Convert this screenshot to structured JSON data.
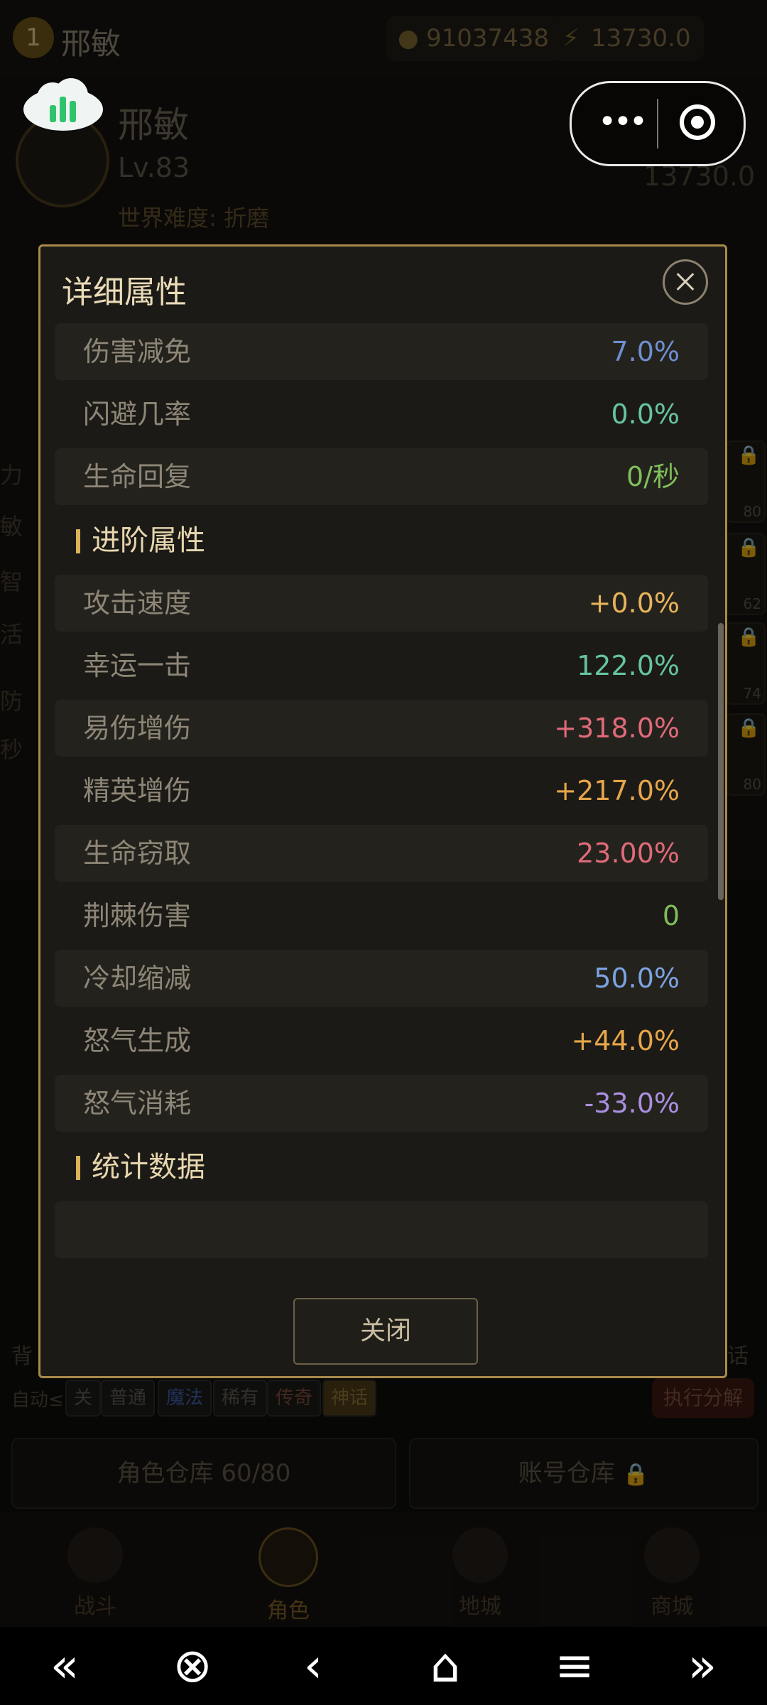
{
  "topbar": {
    "level": "1",
    "name": "邢敏",
    "gold": "91037438",
    "energy": "13730.0"
  },
  "hero": {
    "name": "邢敏",
    "level": "Lv.83",
    "difficulty": "世界难度: 折磨",
    "power": "13730.0"
  },
  "background": {
    "left_stubs": [
      "力",
      "敏",
      "智",
      "活",
      "防",
      "秒"
    ],
    "slot_numbers": [
      "80",
      "62",
      "74",
      "80"
    ],
    "bag_label": "背",
    "myth_stub": "话",
    "auto_label": "自动≤",
    "filters": [
      "关",
      "普通",
      "魔法",
      "稀有",
      "传奇",
      "神话"
    ],
    "decompose": "执行分解",
    "char_warehouse": "角色仓库 60/80",
    "acct_warehouse": "账号仓库"
  },
  "nav": [
    {
      "label": "战斗"
    },
    {
      "label": "角色"
    },
    {
      "label": "地城"
    },
    {
      "label": "商城"
    }
  ],
  "modal": {
    "title": "详细属性",
    "close_label": "关闭",
    "basic": [
      {
        "label": "伤害减免",
        "value": "7.0%",
        "color": "#6f8fd0"
      },
      {
        "label": "闪避几率",
        "value": "0.0%",
        "color": "#66c4a2"
      },
      {
        "label": "生命回复",
        "value": "0/秒",
        "color": "#7fbf5a"
      }
    ],
    "advanced_title": "进阶属性",
    "advanced": [
      {
        "label": "攻击速度",
        "value": "+0.0%",
        "color": "#e6b45a"
      },
      {
        "label": "幸运一击",
        "value": "122.0%",
        "color": "#66c4a2"
      },
      {
        "label": "易伤增伤",
        "value": "+318.0%",
        "color": "#e06a7a"
      },
      {
        "label": "精英增伤",
        "value": "+217.0%",
        "color": "#e6a64a"
      },
      {
        "label": "生命窃取",
        "value": "23.00%",
        "color": "#e06a7a"
      },
      {
        "label": "荆棘伤害",
        "value": "0",
        "color": "#7fbf5a"
      },
      {
        "label": "冷却缩减",
        "value": "50.0%",
        "color": "#7ba3e0"
      },
      {
        "label": "怒气生成",
        "value": "+44.0%",
        "color": "#e6a64a"
      },
      {
        "label": "怒气消耗",
        "value": "-33.0%",
        "color": "#a98fe0"
      }
    ],
    "stats_title": "统计数据"
  },
  "system_nav": [
    "«",
    "⊗",
    "‹",
    "⌂",
    "≡",
    "»"
  ]
}
